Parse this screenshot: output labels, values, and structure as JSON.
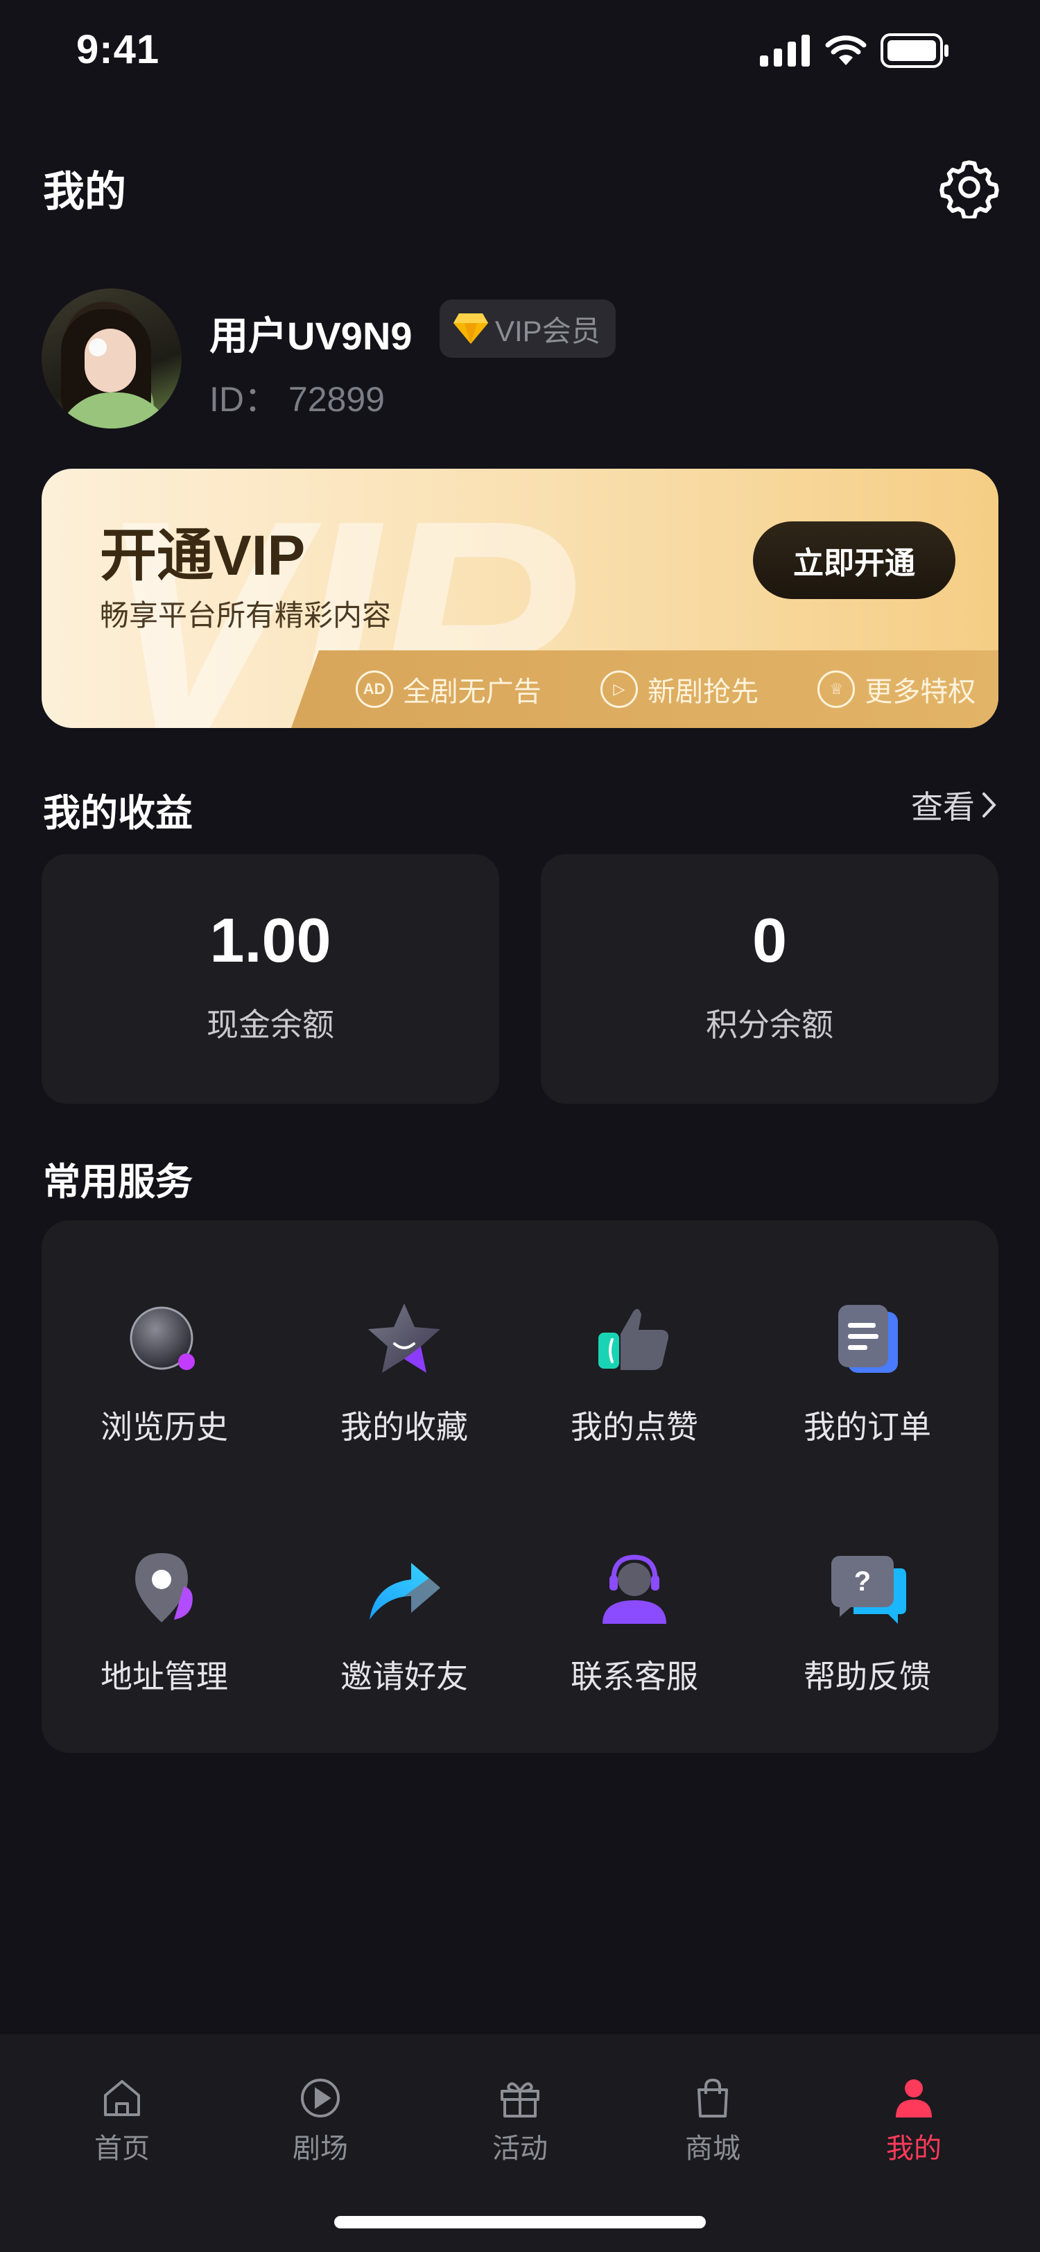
{
  "status_bar": {
    "time": "9:41"
  },
  "header": {
    "title": "我的"
  },
  "profile": {
    "username": "用户UV9N9",
    "vip_badge": "VIP会员",
    "id_label": "ID：",
    "id_value": "72899"
  },
  "vip_card": {
    "title": "开通VIP",
    "subtitle": "畅享平台所有精彩内容",
    "button": "立即开通",
    "watermark": "VIP",
    "perks": [
      {
        "label": "全剧无广告",
        "icon": "ad-icon",
        "glyph": "AD"
      },
      {
        "label": "新剧抢先",
        "icon": "play-circle-icon",
        "glyph": "▷"
      },
      {
        "label": "更多特权",
        "icon": "crown-icon",
        "glyph": "♕"
      }
    ]
  },
  "earnings": {
    "title": "我的收益",
    "view_label": "查看",
    "cards": [
      {
        "value": "1.00",
        "label": "现金余额"
      },
      {
        "value": "0",
        "label": "积分余额"
      }
    ]
  },
  "services": {
    "title": "常用服务",
    "items": [
      {
        "label": "浏览历史",
        "icon": "history-icon"
      },
      {
        "label": "我的收藏",
        "icon": "star-icon"
      },
      {
        "label": "我的点赞",
        "icon": "thumbs-up-icon"
      },
      {
        "label": "我的订单",
        "icon": "order-icon"
      },
      {
        "label": "地址管理",
        "icon": "location-icon"
      },
      {
        "label": "邀请好友",
        "icon": "share-icon"
      },
      {
        "label": "联系客服",
        "icon": "customer-service-icon"
      },
      {
        "label": "帮助反馈",
        "icon": "help-icon"
      }
    ]
  },
  "bottom_nav": {
    "items": [
      {
        "label": "首页",
        "icon": "home-icon",
        "active": false
      },
      {
        "label": "剧场",
        "icon": "play-icon",
        "active": false
      },
      {
        "label": "活动",
        "icon": "gift-icon",
        "active": false
      },
      {
        "label": "商城",
        "icon": "shopping-bag-icon",
        "active": false
      },
      {
        "label": "我的",
        "icon": "profile-icon",
        "active": true
      }
    ]
  },
  "colors": {
    "background": "#121218",
    "card": "#1d1d22",
    "accent": "#ff3a5a",
    "vip_gold": "#f5ce85"
  }
}
